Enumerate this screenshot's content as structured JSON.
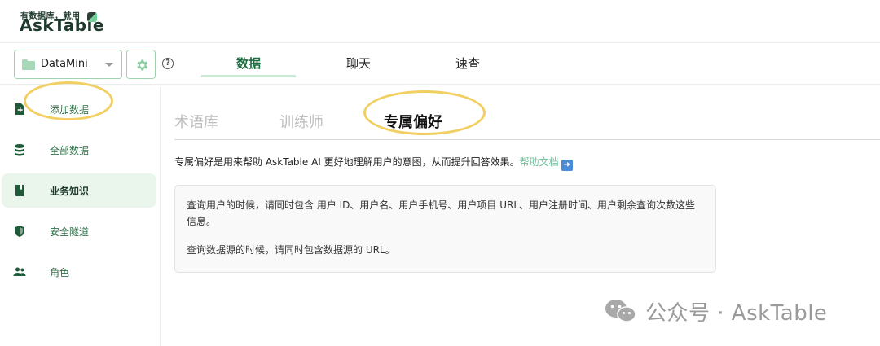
{
  "brand": {
    "slogan": "有数据库，就用",
    "name": "AskTable"
  },
  "toolbar": {
    "datasource": "DataMini",
    "help_glyph": "?",
    "tabs": [
      {
        "label": "数据",
        "active": true
      },
      {
        "label": "聊天",
        "active": false
      },
      {
        "label": "速查",
        "active": false
      }
    ]
  },
  "sidebar": {
    "items": [
      {
        "label": "添加数据",
        "icon": "file-plus-icon"
      },
      {
        "label": "全部数据",
        "icon": "database-icon"
      },
      {
        "label": "业务知识",
        "icon": "book-icon",
        "active": true
      },
      {
        "label": "安全隧道",
        "icon": "shield-icon"
      },
      {
        "label": "角色",
        "icon": "users-icon"
      }
    ]
  },
  "content": {
    "subtabs": [
      {
        "label": "术语库",
        "active": false
      },
      {
        "label": "训练师",
        "active": false
      },
      {
        "label": "专属偏好",
        "active": true
      }
    ],
    "description": "专属偏好是用来帮助 AskTable AI 更好地理解用户的意图，从而提升回答效果。",
    "help_link": "帮助文档",
    "arrow_glyph": "➜",
    "preference_lines": [
      "查询用户的时候，请同时包含 用户 ID、用户名、用户手机号、用户项目 URL、用户注册时间、用户剩余查询次数这些信息。",
      "查询数据源的时候，请同时包含数据源的 URL。"
    ]
  },
  "watermark": {
    "text": "公众号 · AskTable"
  },
  "colors": {
    "accent": "#1e6b3f",
    "link": "#6cc39a",
    "highlight_ring": "#f2cf62",
    "active_bg": "#eaf5ec"
  }
}
